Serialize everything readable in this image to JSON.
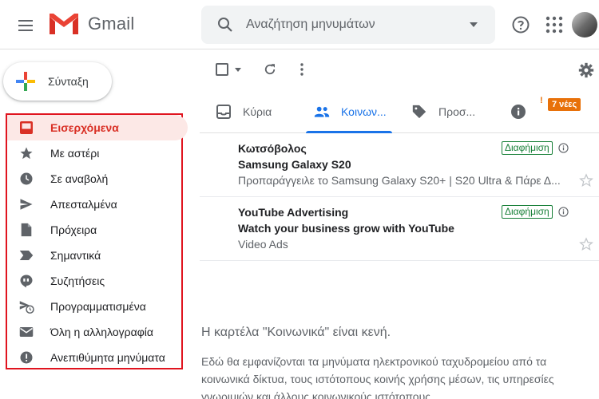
{
  "header": {
    "app_name": "Gmail",
    "search_placeholder": "Αναζήτηση μηνυμάτων"
  },
  "sidebar": {
    "compose_label": "Σύνταξη",
    "items": [
      {
        "label": "Εισερχόμενα",
        "icon": "inbox-icon",
        "active": true
      },
      {
        "label": "Με αστέρι",
        "icon": "star-icon"
      },
      {
        "label": "Σε αναβολή",
        "icon": "clock-icon"
      },
      {
        "label": "Απεσταλμένα",
        "icon": "send-icon"
      },
      {
        "label": "Πρόχειρα",
        "icon": "draft-icon"
      },
      {
        "label": "Σημαντικά",
        "icon": "label-important-icon"
      },
      {
        "label": "Συζητήσεις",
        "icon": "chat-icon"
      },
      {
        "label": "Προγραμματισμένα",
        "icon": "scheduled-send-icon"
      },
      {
        "label": "Όλη η αλληλογραφία",
        "icon": "mail-icon"
      },
      {
        "label": "Ανεπιθύμητα μηνύματα",
        "icon": "spam-icon"
      }
    ]
  },
  "tabs": [
    {
      "label": "Κύρια",
      "icon": "inbox-tab-icon"
    },
    {
      "label": "Κοινων...",
      "icon": "people-icon",
      "active": true
    },
    {
      "label": "Προσ...",
      "icon": "tag-icon"
    },
    {
      "label": "",
      "icon": "info-icon"
    }
  ],
  "tab_badge": "7 νέες",
  "tab_badge_prefix": "!",
  "mails": [
    {
      "sender": "Κωτσόβολος",
      "subject": "Samsung Galaxy S20",
      "snippet": "Προπαράγγειλε το Samsung Galaxy S20+ | S20 Ultra & Πάρε Δ...",
      "badge": "Διαφήμιση"
    },
    {
      "sender": "YouTube Advertising",
      "subject": "Watch your business grow with YouTube",
      "snippet": "Video Ads",
      "badge": "Διαφήμιση"
    }
  ],
  "empty_state": {
    "title": "Η καρτέλα \"Κοινωνικά\" είναι κενή.",
    "description": "Εδώ θα εμφανίζονται τα μηνύματα ηλεκτρονικού ταχυδρομείου από τα κοινωνικά δίκτυα, τους ιστότοπους κοινής χρήσης μέσων, τις υπηρεσίες γνωριμιών και άλλους κοινωνικούς ιστότοπους."
  },
  "colors": {
    "accent_red": "#d93025",
    "tab_blue": "#1a73e8",
    "ad_green": "#188038",
    "badge_orange": "#e8710a",
    "highlight_border": "#e0141f"
  }
}
